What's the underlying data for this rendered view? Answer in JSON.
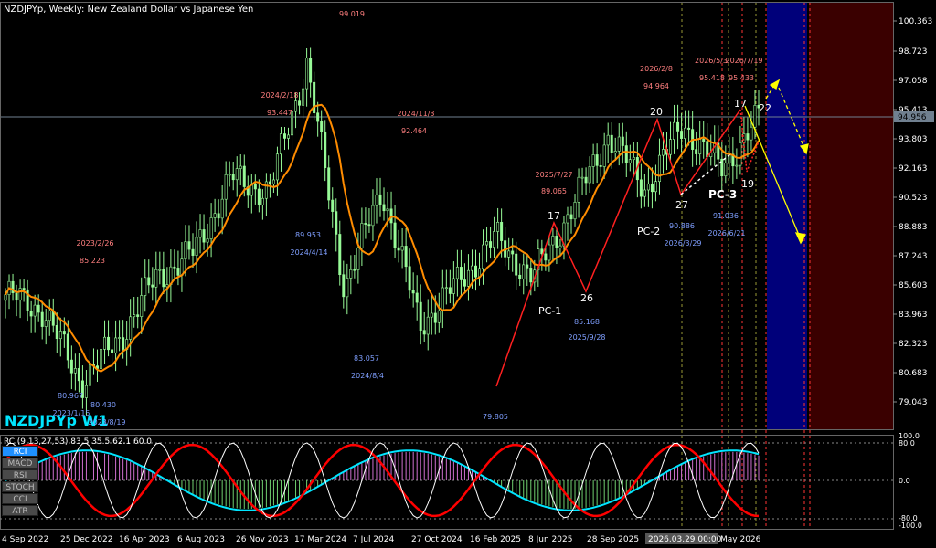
{
  "window": {
    "title": "NZDJPYp, Weekly:  New Zealand Dollar vs Japanese Yen",
    "watermark": "NZDJPYp W1"
  },
  "colors": {
    "candle_up": "#98fb98",
    "candle_down": "#98fb98",
    "ma": "#ff8c00",
    "pattern_line": "#ff2020",
    "forecast": "#ffff00",
    "zone_blue": "#00007a",
    "zone_red": "#3a0000",
    "high_label": "#ff7f7f",
    "low_label": "#7f9fff",
    "rci_red": "#ff0000",
    "rci_white": "#ffffff",
    "rci_cyan": "#00e5ff",
    "hist_pos": "#d070d0",
    "hist_neg": "#70d070"
  },
  "price_axis": {
    "labels": [
      "100.363",
      "98.723",
      "97.058",
      "95.413",
      "93.803",
      "92.163",
      "90.523",
      "88.883",
      "87.243",
      "85.603",
      "83.963",
      "82.323",
      "80.683",
      "79.043"
    ],
    "current_price": "94.956",
    "ylim": [
      78.5,
      101.0
    ]
  },
  "time_axis": {
    "labels": [
      "4 Sep 2022",
      "25 Dec 2022",
      "16 Apr 2023",
      "6 Aug 2023",
      "26 Nov 2023",
      "17 Mar 2024",
      "7 Jul 2024",
      "27 Oct 2024",
      "16 Feb 2025",
      "8 Jun 2025",
      "28 Sep 2025",
      "2026.03.29 00:00",
      "May 2026"
    ]
  },
  "annotations": {
    "highs": [
      {
        "date": "",
        "price": "99.019"
      },
      {
        "date": "2024/2/18",
        "price": "93.447"
      },
      {
        "date": "2024/11/3",
        "price": "92.464"
      },
      {
        "date": "2023/2/26",
        "price": "85.223"
      },
      {
        "date": "2025/7/27",
        "price": "89.065"
      },
      {
        "date": "2026/2/8",
        "price": "94.964"
      },
      {
        "date": "2026/5/3",
        "price": "95.418"
      },
      {
        "date": "2026/7/19",
        "price": "95.433"
      }
    ],
    "lows": [
      {
        "date": "2024/4/14",
        "price": "89.953"
      },
      {
        "date": "2024/8/4",
        "price": "83.057"
      },
      {
        "date": "2023/1/15",
        "price": "80.967"
      },
      {
        "date": "2023/8/19",
        "price": "80.430"
      },
      {
        "date": "",
        "price": "79.805"
      },
      {
        "date": "2025/9/28",
        "price": "85.168"
      },
      {
        "date": "2026/3/29",
        "price": "90.886"
      },
      {
        "date": "2026/6/21",
        "price": "91.036"
      }
    ],
    "counts": [
      "17",
      "26",
      "20",
      "27",
      "17",
      "19",
      "22"
    ],
    "patterns": [
      "PC-1",
      "PC-2",
      "PC-3"
    ]
  },
  "indicator": {
    "header": "RCI(9,13,27,53) 83.5 35.5 62.1 60.0",
    "axis_labels": [
      "100.0",
      "80.0",
      "0.0",
      "-80.0",
      "-100.0"
    ],
    "buttons": [
      "RCI",
      "MACD",
      "RSI",
      "STOCH",
      "CCI",
      "ATR"
    ],
    "active_button": "RCI"
  },
  "chart_data": {
    "type": "candlestick",
    "series": [
      {
        "name": "price_close_path",
        "x": [
          "2022-09",
          "2022-12",
          "2023-01",
          "2023-04",
          "2023-08",
          "2023-11",
          "2024-02",
          "2024-04",
          "2024-06",
          "2024-08",
          "2024-11",
          "2025-02",
          "2025-04",
          "2025-07",
          "2025-09",
          "2025-12",
          "2026-02",
          "2026-03",
          "2026-05",
          "2026-06",
          "2026-07"
        ],
        "values": [
          85.6,
          84.8,
          81.0,
          83.2,
          86.5,
          87.8,
          91.8,
          91.0,
          97.8,
          86.0,
          91.2,
          84.0,
          86.2,
          88.6,
          86.5,
          90.0,
          94.0,
          91.2,
          94.6,
          92.2,
          94.9
        ]
      }
    ],
    "ylim": [
      78.5,
      101.0
    ]
  }
}
